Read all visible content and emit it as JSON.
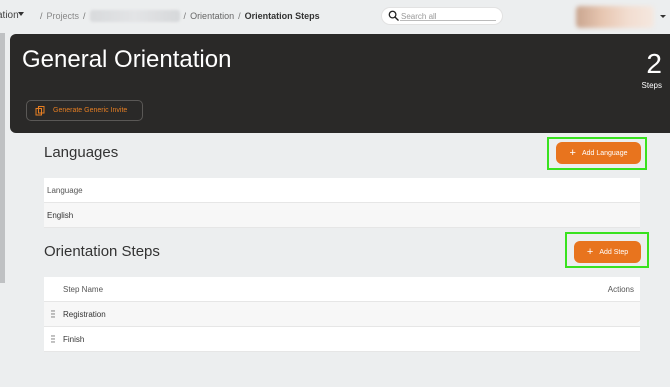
{
  "breadcrumbs": {
    "first": "ation",
    "projects": "Projects",
    "orientation": "Orientation",
    "current": "Orientation Steps",
    "separator": "/"
  },
  "search": {
    "placeholder": "Search all",
    "icon": "search-icon"
  },
  "hero": {
    "title": "General Orientation",
    "invite_label": "Generate Generic Invite",
    "steps_count": "2",
    "steps_label": "Steps"
  },
  "languages": {
    "title": "Languages",
    "add_label": "Add Language",
    "column": "Language",
    "rows": [
      "English"
    ]
  },
  "steps": {
    "title": "Orientation Steps",
    "add_label": "Add Step",
    "columns": {
      "name": "Step Name",
      "actions": "Actions"
    },
    "rows": [
      "Registration",
      "Finish"
    ]
  },
  "colors": {
    "accent": "#e8741e",
    "hero_bg": "#2a2928",
    "highlight": "#39e21f",
    "page_bg": "#eceeef"
  }
}
